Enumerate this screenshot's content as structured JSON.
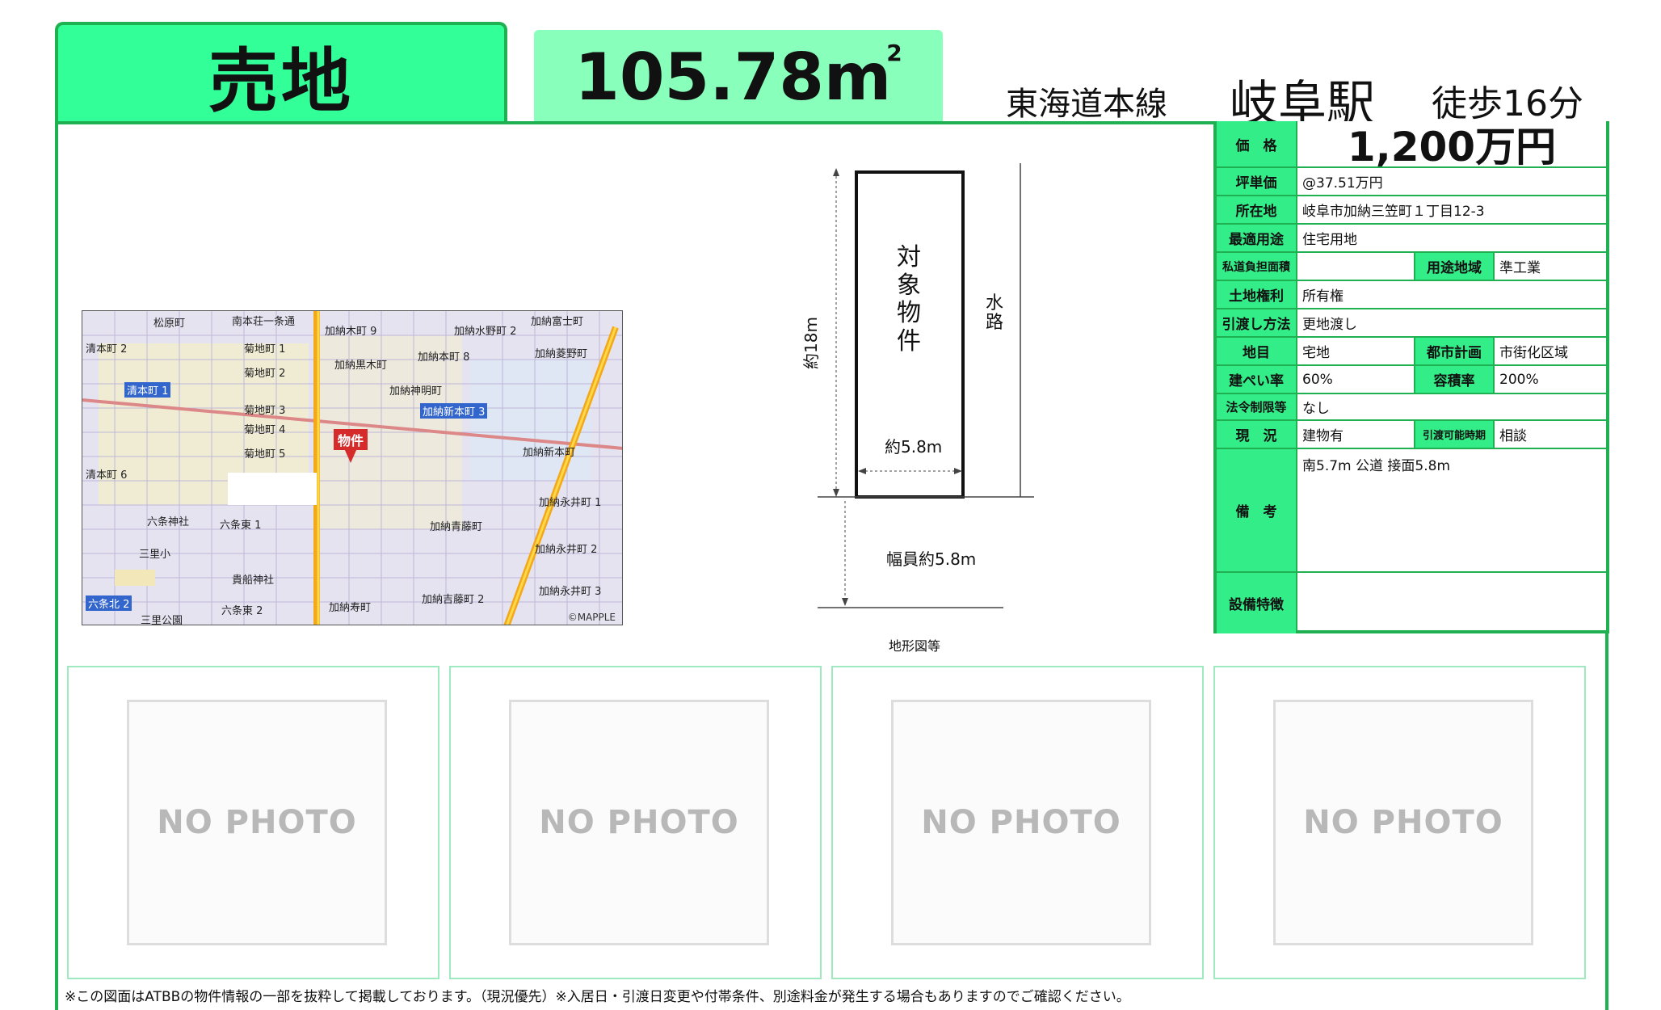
{
  "header": {
    "category": "売地",
    "area": "105.78m",
    "area_unit_sup": "2",
    "line": "東海道本線",
    "station": "岐阜駅",
    "walk": "徒歩16分"
  },
  "info": {
    "price": {
      "label": "価　格",
      "value": "1,200万円"
    },
    "tsubo_price": {
      "label": "坪単価",
      "value": "@37.51万円"
    },
    "location": {
      "label": "所在地",
      "value": "岐阜市加納三笠町１丁目12-3"
    },
    "best_use": {
      "label": "最適用途",
      "value": "住宅用地"
    },
    "private_road": {
      "label": "私道負担面積",
      "value": ""
    },
    "use_zone": {
      "label": "用途地域",
      "value": "準工業"
    },
    "land_right": {
      "label": "土地権利",
      "value": "所有権"
    },
    "delivery": {
      "label": "引渡し方法",
      "value": "更地渡し"
    },
    "land_category": {
      "label": "地目",
      "value": "宅地"
    },
    "city_plan": {
      "label": "都市計画",
      "value": "市街化区域"
    },
    "coverage": {
      "label": "建ぺい率",
      "value": "60%"
    },
    "floor_ratio": {
      "label": "容積率",
      "value": "200%"
    },
    "legal_limits": {
      "label": "法令制限等",
      "value": "なし"
    },
    "status": {
      "label": "現　況",
      "value": "建物有"
    },
    "handover_time": {
      "label": "引渡可能時期",
      "value": "相談"
    },
    "remarks": {
      "label": "備　考",
      "value": "南5.7m 公道 接面5.8m"
    },
    "equipment": {
      "label": "設備特徴",
      "value": ""
    }
  },
  "map": {
    "badge": "物件",
    "credit": "©MAPPLE",
    "labels": [
      "松原町",
      "南本荘一条通",
      "加納富士町",
      "清本町 2",
      "菊地町 1",
      "加納木町 9",
      "加納水野町 2",
      "加納菱野町",
      "菊地町 2",
      "加納黒木町",
      "加納本町 8",
      "清本町 1",
      "菊地町 3",
      "加納神明町",
      "加納新本町 3",
      "菊地町 4",
      "菊地町 5",
      "加納新本町",
      "加納永井町 1",
      "清本町 6",
      "六条東 1",
      "加納青藤町",
      "六条北 2",
      "六条東 2",
      "三里公園",
      "加納永井町 3",
      "加納寿町",
      "加納吉藤町 2",
      "加納永井町 2",
      "六条神社",
      "三里小",
      "貴船神社"
    ]
  },
  "diagram": {
    "target": "対象物件",
    "waterway": "水路",
    "length": "約18m",
    "width": "約5.8m",
    "road": "幅員約5.8m",
    "caption": "地形図等"
  },
  "photos": [
    "NO PHOTO",
    "NO PHOTO",
    "NO PHOTO",
    "NO PHOTO"
  ],
  "footnote": "※この図面はATBBの物件情報の一部を抜粋して掲載しております。（現況優先）※入居日・引渡日変更や付帯条件、別途料金が発生する場合もありますのでご確認ください。",
  "colors": {
    "accent": "#33ff99",
    "border": "#1fb052",
    "area_tab": "#88ffbb",
    "header_cell": "#33ee88"
  }
}
